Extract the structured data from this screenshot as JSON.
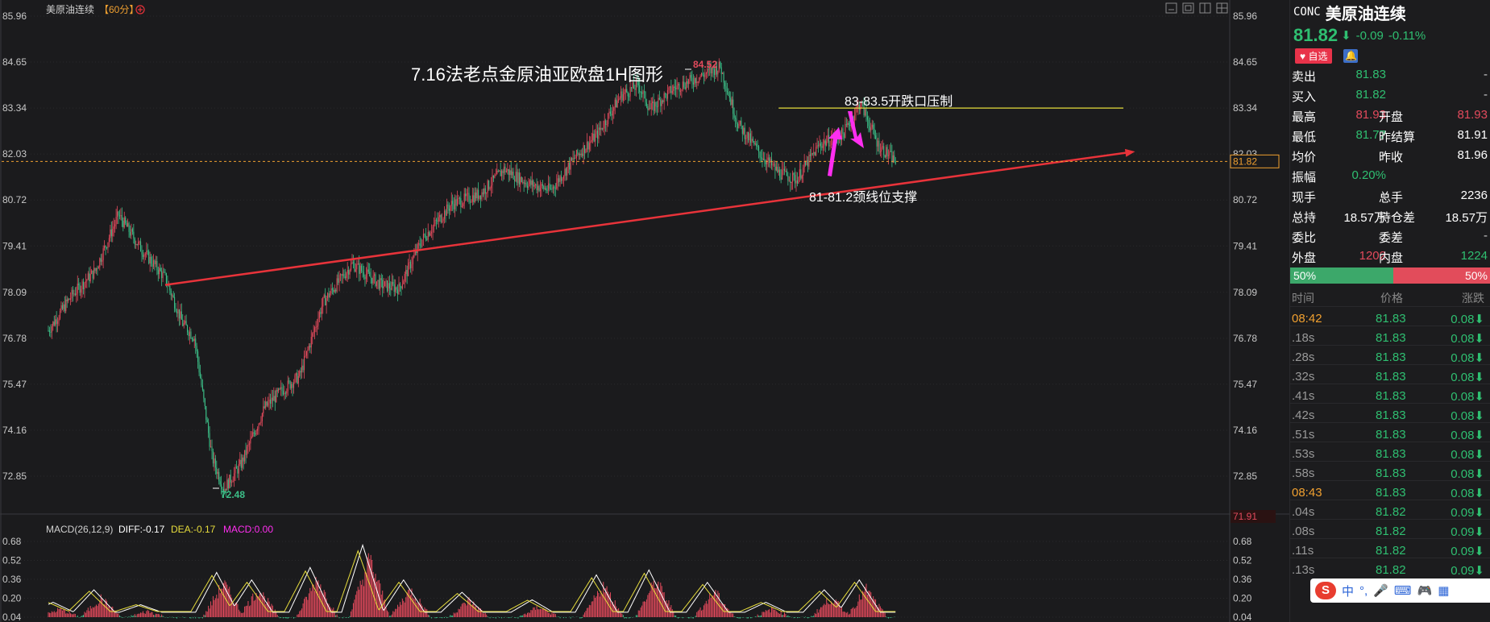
{
  "chart_header": {
    "instrument": "美原油连续",
    "period": "【60分】",
    "settings_icon": "circle-plus-icon"
  },
  "window_controls": [
    "minimize-icon",
    "restore-icon",
    "layout-icon",
    "grid-icon"
  ],
  "annotations": {
    "title": "7.16法老点金原油亚欧盘1H图形",
    "resistance_label": "83-83.5开跌口压制",
    "support_label": "81-81.2颈线位支撑",
    "high_label": "84.52",
    "low_label": "72.48"
  },
  "macd_header": {
    "name": "MACD(26,12,9)",
    "diff": "DIFF:-0.17",
    "dea": "DEA:-0.17",
    "macd": "MACD:0.00"
  },
  "colors": {
    "up": "#e34a5c",
    "down": "#3cbf88",
    "trendline": "#e8333a",
    "resistance": "#e6dc3c",
    "arrow": "#ff2ef0",
    "dea": "#e6dc3c",
    "diff": "#ffffff",
    "macd_label": "#ff2ef0",
    "last_price": "#f0a030"
  },
  "chart_data": {
    "type": "candlestick",
    "price_axis": {
      "min": 71.91,
      "max": 85.96,
      "ticks": [
        "85.96",
        "84.65",
        "83.34",
        "82.03",
        "80.72",
        "79.41",
        "78.09",
        "76.78",
        "75.47",
        "74.16",
        "72.85"
      ],
      "bottom_label": "71.91",
      "last_price": "81.82"
    },
    "macd_axis": {
      "min": 0.04,
      "max": 0.68,
      "ticks": [
        "0.68",
        "0.52",
        "0.36",
        "0.20",
        "0.04"
      ]
    },
    "price_path": [
      [
        0,
        77.0
      ],
      [
        20,
        78.0
      ],
      [
        40,
        78.7
      ],
      [
        60,
        80.3
      ],
      [
        80,
        79.3
      ],
      [
        100,
        78.5
      ],
      [
        115,
        77.2
      ],
      [
        125,
        76.8
      ],
      [
        140,
        73.4
      ],
      [
        150,
        72.48
      ],
      [
        165,
        73.2
      ],
      [
        185,
        74.8
      ],
      [
        200,
        75.3
      ],
      [
        215,
        75.7
      ],
      [
        235,
        77.8
      ],
      [
        260,
        78.9
      ],
      [
        285,
        78.3
      ],
      [
        300,
        78.2
      ],
      [
        320,
        79.6
      ],
      [
        345,
        80.6
      ],
      [
        370,
        80.9
      ],
      [
        390,
        81.6
      ],
      [
        410,
        81.2
      ],
      [
        430,
        81.0
      ],
      [
        450,
        81.9
      ],
      [
        470,
        82.6
      ],
      [
        490,
        83.7
      ],
      [
        505,
        84.0
      ],
      [
        515,
        83.3
      ],
      [
        535,
        83.9
      ],
      [
        555,
        84.2
      ],
      [
        575,
        84.52
      ],
      [
        590,
        82.9
      ],
      [
        610,
        82.0
      ],
      [
        625,
        81.5
      ],
      [
        640,
        81.3
      ],
      [
        660,
        82.3
      ],
      [
        680,
        82.6
      ],
      [
        695,
        83.5
      ],
      [
        710,
        82.3
      ],
      [
        725,
        81.82
      ]
    ],
    "macd_hist_peaks": [
      [
        10,
        0.12
      ],
      [
        45,
        0.22
      ],
      [
        85,
        0.1
      ],
      [
        150,
        0.36
      ],
      [
        180,
        0.3
      ],
      [
        230,
        0.4
      ],
      [
        275,
        0.58
      ],
      [
        310,
        0.3
      ],
      [
        360,
        0.2
      ],
      [
        420,
        0.14
      ],
      [
        475,
        0.34
      ],
      [
        520,
        0.38
      ],
      [
        570,
        0.28
      ],
      [
        620,
        0.12
      ],
      [
        670,
        0.22
      ],
      [
        700,
        0.3
      ],
      [
        725,
        0.04
      ]
    ],
    "support_line": {
      "from": [
        100,
        78.3
      ],
      "to": [
        930,
        82.1
      ]
    },
    "resistance_line": {
      "from": [
        625,
        83.34
      ],
      "to": [
        920,
        83.34
      ]
    }
  },
  "quote_panel": {
    "code": "CONC",
    "name": "美原油连续",
    "price": "81.82",
    "change": "-0.09",
    "change_pct": "-0.11%",
    "fav_button": "自选",
    "rows": [
      {
        "l1": "卖出",
        "v1": "81.83",
        "c1": "green",
        "l2": "",
        "v2": "-",
        "c2": "gray"
      },
      {
        "l1": "买入",
        "v1": "81.82",
        "c1": "green",
        "l2": "",
        "v2": "-",
        "c2": "gray"
      },
      {
        "l1": "最高",
        "v1": "81.93",
        "c1": "red",
        "l2": "开盘",
        "v2": "81.93",
        "c2": "red"
      },
      {
        "l1": "最低",
        "v1": "81.77",
        "c1": "green",
        "l2": "昨结算",
        "v2": "81.91",
        "c2": "white"
      },
      {
        "l1": "均价",
        "v1": "-",
        "c1": "gray",
        "l2": "昨收",
        "v2": "81.96",
        "c2": "white"
      },
      {
        "l1": "振幅",
        "v1": "0.20%",
        "c1": "green",
        "l2": "",
        "v2": "",
        "c2": "gray"
      },
      {
        "l1": "现手",
        "v1": "-",
        "c1": "gray",
        "l2": "总手",
        "v2": "2236",
        "c2": "white"
      },
      {
        "l1": "总持",
        "v1": "18.57万",
        "c1": "white",
        "l2": "持仓差",
        "v2": "18.57万",
        "c2": "white"
      },
      {
        "l1": "委比",
        "v1": "-",
        "c1": "gray",
        "l2": "委差",
        "v2": "-",
        "c2": "gray"
      },
      {
        "l1": "外盘",
        "v1": "1202",
        "c1": "red",
        "l2": "内盘",
        "v2": "1224",
        "c2": "green"
      }
    ],
    "buy_ratio": "50%",
    "sell_ratio": "50%",
    "tick_headers": [
      "时间",
      "价格",
      "涨跌"
    ],
    "ticks": [
      {
        "time": "08:42",
        "price": "81.83",
        "change": "0.08",
        "hl": true
      },
      {
        "time": ".18s",
        "price": "81.83",
        "change": "0.08",
        "hl": false
      },
      {
        "time": ".28s",
        "price": "81.83",
        "change": "0.08",
        "hl": false
      },
      {
        "time": ".32s",
        "price": "81.83",
        "change": "0.08",
        "hl": false
      },
      {
        "time": ".41s",
        "price": "81.83",
        "change": "0.08",
        "hl": false
      },
      {
        "time": ".42s",
        "price": "81.83",
        "change": "0.08",
        "hl": false
      },
      {
        "time": ".51s",
        "price": "81.83",
        "change": "0.08",
        "hl": false
      },
      {
        "time": ".53s",
        "price": "81.83",
        "change": "0.08",
        "hl": false
      },
      {
        "time": ".58s",
        "price": "81.83",
        "change": "0.08",
        "hl": false
      },
      {
        "time": "08:43",
        "price": "81.83",
        "change": "0.08",
        "hl": true
      },
      {
        "time": ".04s",
        "price": "81.82",
        "change": "0.09",
        "hl": false
      },
      {
        "time": ".08s",
        "price": "81.82",
        "change": "0.09",
        "hl": false
      },
      {
        "time": ".11s",
        "price": "81.82",
        "change": "0.09",
        "hl": false
      },
      {
        "time": ".13s",
        "price": "81.82",
        "change": "0.09",
        "hl": false
      }
    ]
  },
  "ime_toolbar": {
    "logo": "S",
    "lang": "中"
  }
}
